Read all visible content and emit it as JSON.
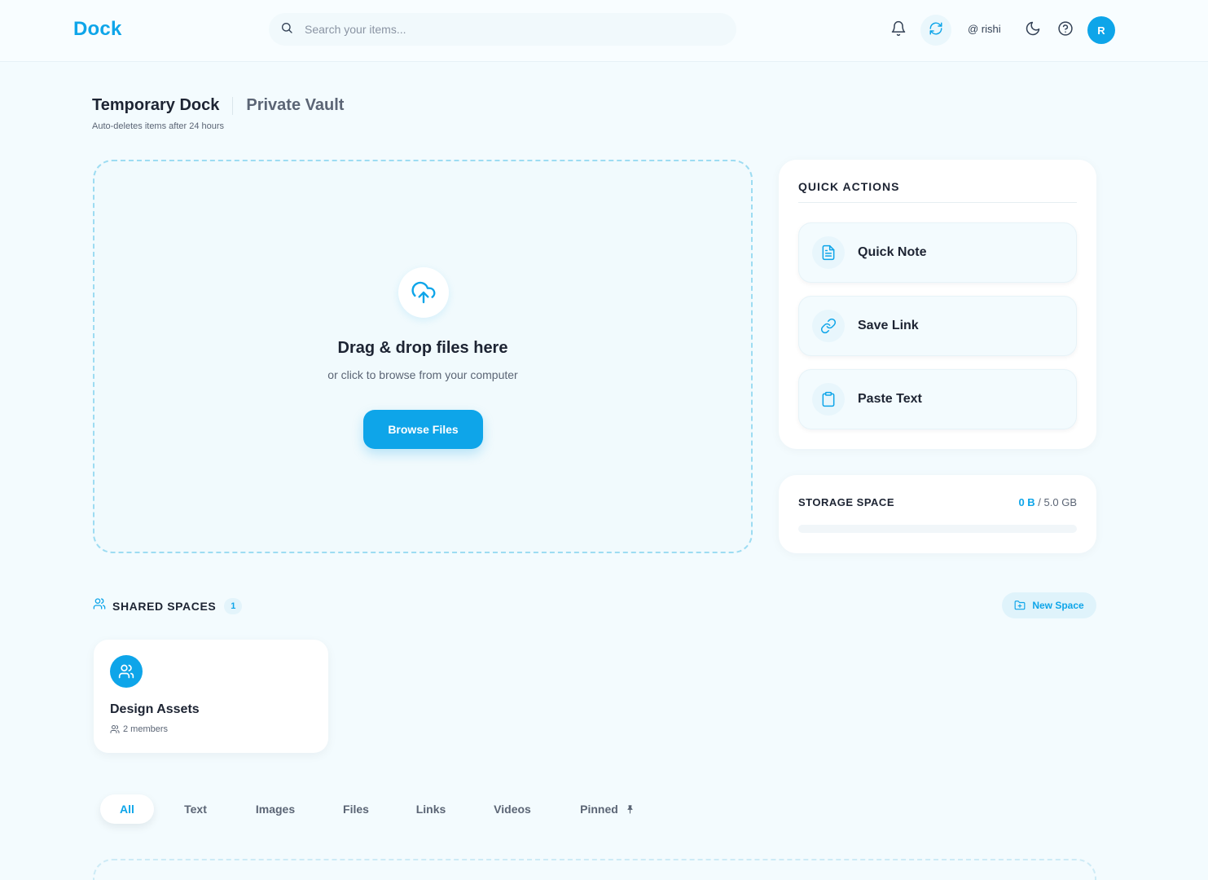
{
  "header": {
    "logo": "Dock",
    "search_placeholder": "Search your items...",
    "username": "@ rishi",
    "avatar_initial": "R",
    "icons": [
      "bell-icon",
      "sync-icon",
      "moon-icon",
      "help-icon"
    ]
  },
  "page": {
    "tabs": [
      "Temporary Dock",
      "Private Vault"
    ],
    "active_tab": "Temporary Dock",
    "subtitle": "Auto-deletes items after 24 hours"
  },
  "dropzone": {
    "title": "Drag & drop files here",
    "subtitle": "or click to browse from your computer",
    "button": "Browse Files"
  },
  "quick_actions": {
    "heading": "QUICK ACTIONS",
    "items": [
      {
        "label": "Quick Note",
        "icon": "note-icon"
      },
      {
        "label": "Save Link",
        "icon": "link-icon"
      },
      {
        "label": "Paste Text",
        "icon": "clipboard-icon"
      }
    ]
  },
  "storage": {
    "heading": "STORAGE SPACE",
    "used": "0 B",
    "total": "/ 5.0 GB",
    "used_fraction": 0
  },
  "shared_spaces": {
    "heading": "SHARED SPACES",
    "count": "1",
    "new_button": "New Space",
    "spaces": [
      {
        "name": "Design Assets",
        "members": "2 members"
      }
    ]
  },
  "filters": {
    "tabs": [
      "All",
      "Text",
      "Images",
      "Files",
      "Links",
      "Videos",
      "Pinned"
    ],
    "active": "All"
  },
  "colors": {
    "accent": "#0ea5e9",
    "background": "#f3fbfe",
    "text": "#1d2433",
    "muted": "#5b6575"
  }
}
